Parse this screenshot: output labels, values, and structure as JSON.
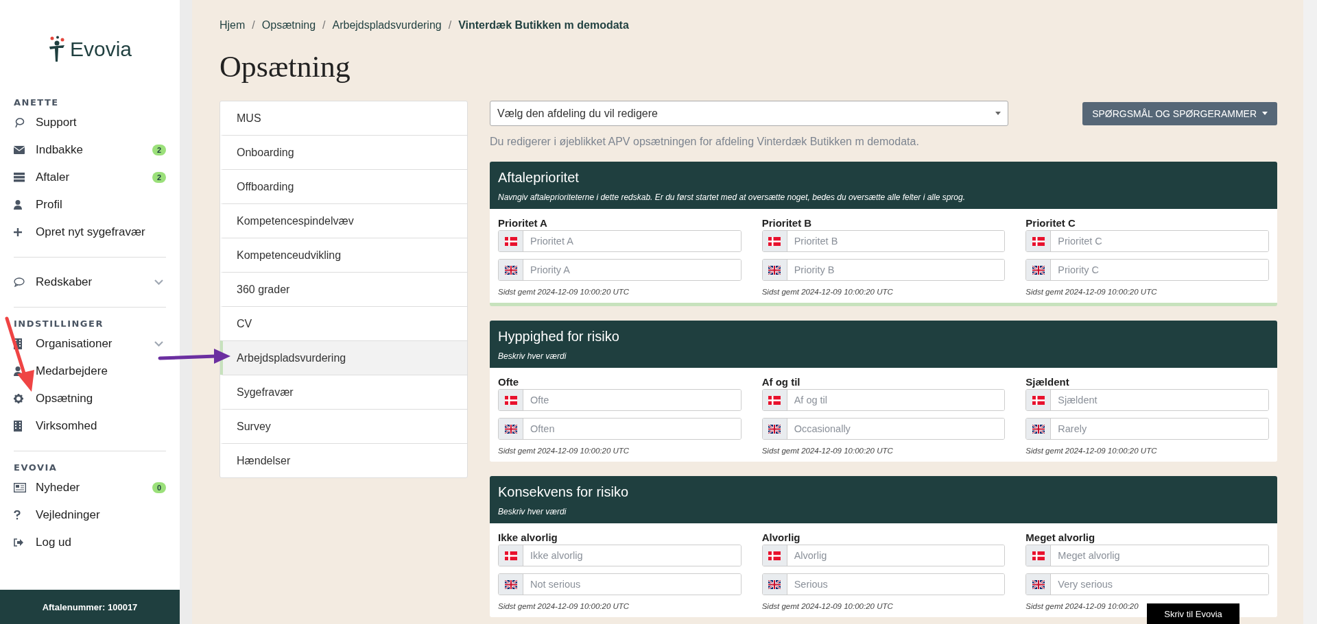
{
  "sidebar": {
    "logo": "Evovia",
    "groups": [
      {
        "heading": "ANETTE",
        "items": [
          {
            "label": "Support",
            "expandable": false
          },
          {
            "label": "Indbakke",
            "badge": "2",
            "expandable": false
          },
          {
            "label": "Aftaler",
            "badge": "2",
            "expandable": false
          },
          {
            "label": "Profil",
            "expandable": false
          },
          {
            "label": "Opret nyt sygefravær",
            "expandable": false
          }
        ]
      },
      {
        "items": [
          {
            "label": "Redskaber",
            "expandable": true
          }
        ]
      },
      {
        "heading": "INDSTILLINGER",
        "items": [
          {
            "label": "Organisationer",
            "expandable": true
          },
          {
            "label": "Medarbejdere",
            "expandable": false
          },
          {
            "label": "Opsætning",
            "expandable": false
          },
          {
            "label": "Virksomhed",
            "expandable": false
          }
        ]
      },
      {
        "heading": "EVOVIA",
        "items": [
          {
            "label": "Nyheder",
            "badge": "0",
            "expandable": false
          },
          {
            "label": "Vejledninger",
            "expandable": false
          },
          {
            "label": "Log ud",
            "expandable": false
          }
        ]
      }
    ],
    "footer": "Aftalenummer: 100017"
  },
  "breadcrumbs": {
    "separator": "/",
    "items": [
      "Hjem",
      "Opsætning",
      "Arbejdspladsvurdering",
      "Vinterdæk Butikken m demodata"
    ]
  },
  "title": "Opsætning",
  "menu": [
    {
      "label": "MUS",
      "selected": false
    },
    {
      "label": "Onboarding",
      "selected": false
    },
    {
      "label": "Offboarding",
      "selected": false
    },
    {
      "label": "Kompetencespindelvæv",
      "selected": false
    },
    {
      "label": "Kompetenceudvikling",
      "selected": false
    },
    {
      "label": "360 grader",
      "selected": false
    },
    {
      "label": "CV",
      "selected": false
    },
    {
      "label": "Arbejdspladsvurdering",
      "selected": true
    },
    {
      "label": "Sygefravær",
      "selected": false
    },
    {
      "label": "Survey",
      "selected": false
    },
    {
      "label": "Hændelser",
      "selected": false
    }
  ],
  "department_select": {
    "placeholder": "Vælg den afdeling du vil redigere"
  },
  "questions_button": "SPØRGSMÅL OG SPØRGERAMMER",
  "info": "Du redigerer i øjeblikket APV opsætningen for afdeling Vinterdæk Butikken m demodata.",
  "sections": [
    {
      "title": "Aftaleprioritet",
      "subtitle": "Navngiv aftaleprioriteterne i dette redskab. Er du først startet med at oversætte noget, bedes du oversætte alle felter i alle sprog.",
      "saved": true,
      "fields": [
        {
          "label": "Prioritet A",
          "danish_placeholder": "Prioritet A",
          "english_placeholder": "Priority A",
          "saved_note": "Sidst gemt 2024-12-09 10:00:20 UTC"
        },
        {
          "label": "Prioritet B",
          "danish_placeholder": "Prioritet B",
          "english_placeholder": "Priority B",
          "saved_note": "Sidst gemt 2024-12-09 10:00:20 UTC"
        },
        {
          "label": "Prioritet C",
          "danish_placeholder": "Prioritet C",
          "english_placeholder": "Priority C",
          "saved_note": "Sidst gemt 2024-12-09 10:00:20 UTC"
        }
      ]
    },
    {
      "title": "Hyppighed for risiko",
      "subtitle": "Beskriv hver værdi",
      "saved": false,
      "fields": [
        {
          "label": "Ofte",
          "danish_placeholder": "Ofte",
          "english_placeholder": "Often",
          "saved_note": "Sidst gemt 2024-12-09 10:00:20 UTC"
        },
        {
          "label": "Af og til",
          "danish_placeholder": "Af og til",
          "english_placeholder": "Occasionally",
          "saved_note": "Sidst gemt 2024-12-09 10:00:20 UTC"
        },
        {
          "label": "Sjældent",
          "danish_placeholder": "Sjældent",
          "english_placeholder": "Rarely",
          "saved_note": "Sidst gemt 2024-12-09 10:00:20 UTC"
        }
      ]
    },
    {
      "title": "Konsekvens for risiko",
      "subtitle": "Beskriv hver værdi",
      "saved": false,
      "fields": [
        {
          "label": "Ikke alvorlig",
          "danish_placeholder": "Ikke alvorlig",
          "english_placeholder": "Not serious",
          "saved_note": "Sidst gemt 2024-12-09 10:00:20 UTC"
        },
        {
          "label": "Alvorlig",
          "danish_placeholder": "Alvorlig",
          "english_placeholder": "Serious",
          "saved_note": "Sidst gemt 2024-12-09 10:00:20 UTC"
        },
        {
          "label": "Meget alvorlig",
          "danish_placeholder": "Meget alvorlig",
          "english_placeholder": "Very serious",
          "saved_note": "Sidst gemt 2024-12-09 10:00:20"
        }
      ]
    }
  ],
  "chat_tab": "Skriv til Evovia"
}
